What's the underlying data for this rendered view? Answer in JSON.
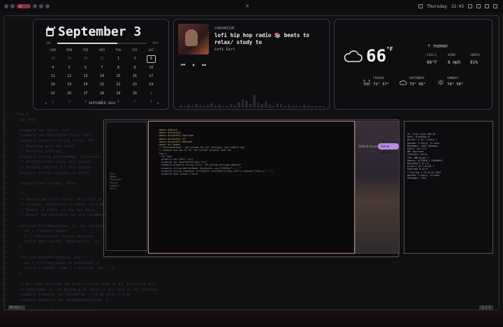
{
  "topbar": {
    "center_glyph": "⌘",
    "day": "Thursday",
    "time": "21:43"
  },
  "calendar": {
    "title": "September 3",
    "progress_left": "28%",
    "progress_right": "67%",
    "progress_fraction": 0.67,
    "weekdays": [
      "SUN",
      "MON",
      "TUE",
      "WED",
      "THU",
      "FRI",
      "SAT"
    ],
    "days": [
      [
        "28",
        "29",
        "30",
        "31",
        "1",
        "2",
        "3"
      ],
      [
        "4",
        "5",
        "6",
        "7",
        "8",
        "9",
        "10"
      ],
      [
        "11",
        "12",
        "13",
        "14",
        "15",
        "16",
        "17"
      ],
      [
        "18",
        "19",
        "20",
        "21",
        "22",
        "23",
        "24"
      ],
      [
        "25",
        "26",
        "27",
        "28",
        "29",
        "30",
        "1"
      ],
      [
        "2",
        "3",
        "4",
        "5",
        "6",
        "7",
        "8"
      ]
    ],
    "today": "3",
    "footer_prev": "◂",
    "footer_label": "SEPTEMBER 2024",
    "footer_next": "▸"
  },
  "media": {
    "source": "CHROMIUM",
    "title": "lofi hip hop radio 📚 beats to relax/ study to",
    "artist": "Lofi Girl",
    "prev_icon": "⏮",
    "play_icon": "⏸",
    "next_icon": "⏭"
  },
  "weather": {
    "temp": "66",
    "unit": "°F",
    "location": "FREMONT",
    "feels_label": "FEELS",
    "feels_value": "66°F",
    "wind_label": "WIND",
    "wind_value": "6 mph",
    "humid_label": "HUMID",
    "humid_value": "81%",
    "forecast": [
      {
        "day": "FRIDAY",
        "temps": "71° 57°",
        "icon": "fog-icon"
      },
      {
        "day": "SATURDAY",
        "temps": "73° 56°",
        "icon": "cloud-icon"
      },
      {
        "day": "SUNDAY",
        "temps": "74° 58°",
        "icon": "sun-icon"
      }
    ]
  },
  "editor": {
    "lines": [
      {
        "n": "12",
        "t": "Item {"
      },
      {
        "n": "13",
        "t": "  id: root"
      },
      {
        "n": "14",
        "t": ""
      },
      {
        "n": "15",
        "t": "  property var shell: null"
      },
      {
        "n": "16",
        "t": "  property var displaySettings: null"
      },
      {
        "n": "17",
        "t": "  readonly property string title: \"Qt\""
      },
      {
        "n": "18",
        "t": "  // Mounting with the shell..."
      },
      {
        "n": "19",
        "t": "  // Mounting settings..."
      },
      {
        "n": "20",
        "t": "  property string monitorName: Quickshell"
      },
      {
        "n": "21",
        "t": "  // Notifications using this object..."
      },
      {
        "n": "22",
        "t": "  // Display options for this window"
      },
      {
        "n": "23",
        "t": "  property string iconpath:qs.Paths"
      },
      {
        "n": "24",
        "t": ""
      },
      {
        "n": "25",
        "t": "  property bool visual: false"
      },
      {
        "n": "26",
        "t": ""
      },
      {
        "n": "27",
        "t": "  //"
      },
      {
        "n": "28",
        "t": "  // Serialized list (notes) this file is"
      },
      {
        "n": "29",
        "t": "  // Strings, conversion to number on a data"
      },
      {
        "n": "30",
        "t": "  // Number of ticks, string key value"
      },
      {
        "n": "31",
        "t": "  // expert the available (we are recommending"
      },
      {
        "n": "32",
        "t": ""
      },
      {
        "n": "33",
        "t": "  function FitToNum(value, lo, hi, fallback"
      },
      {
        "n": "34",
        "t": "    var n = Number(value)"
      },
      {
        "n": "35",
        "t": "    if (!isFinite(n)) return fallback"
      },
      {
        "n": "36",
        "t": "    return Math.min(hi, Math.max(lo, n))"
      },
      {
        "n": "37",
        "t": "  }"
      },
      {
        "n": "38",
        "t": ""
      },
      {
        "n": "39",
        "t": "  function boundText(value, max) {"
      },
      {
        "n": "40",
        "t": "    var s = String(value == undefined ||"
      },
      {
        "n": "41",
        "t": "    return s.length > max ? s.slice(0, max) : s"
      },
      {
        "n": "42",
        "t": "  }"
      },
      {
        "n": "43",
        "t": ""
      },
      {
        "n": "44",
        "t": "  // All code executed (no pixels before gone at all BlurStack etc)"
      },
      {
        "n": "45",
        "t": "  // Timestamps at the minute with (easy to do) this is all setting"
      },
      {
        "n": "46",
        "t": "  readonly property var validFrom: /^[A-Za-z0-9._\\-]+$/"
      },
      {
        "n": "47",
        "t": "  readonly property int asideWidthMaximum: 7"
      },
      {
        "n": "48",
        "t": ""
      },
      {
        "n": "49",
        "t": "  function semiIsArray(list, fallback) {"
      },
      {
        "n": "50",
        "t": "    if (!Array.isArray(list)) return fallback"
      },
      {
        "n": "51",
        "t": "    var out = []"
      }
    ]
  },
  "overview": {
    "browser_tab": "Default browser",
    "browser_button": "Set as default",
    "main_code": [
      "import QtQuick",
      "import Quickshell",
      "import Quickshell.Hyprland",
      "import Quickshell.Io",
      "import Quickshell.Wayland",
      "import qs.Common",
      "",
      "// SettingsWindow - one window for all settings; this module and",
      "// exposes one new UI for the current display (and the",
      "",
      "Item {",
      "  id: root",
      "",
      "  property var shell: null",
      "  property var displaySettings: null",
      "  readonly property string title: \"QS_github_settings_modules\"",
      "  property string monitorName: Quickshell.env(\"DISPLAY\") || \"\"",
      "  property string iconpath: StringCalc.resolveUri(\"save.conf\").replace(\"file://\", \"\")",
      "",
      "  property bool visual: false"
    ],
    "side_code": [
      "OS: Arch Linux x86_64",
      "Host: ThinkPad X1",
      "Kernel: 6.10.7-arch1-1",
      "Uptime: 3 hours, 12 mins",
      "Packages: 1204 (pacman)",
      "Shell: zsh 5.9",
      "WM: Hyprland",
      "Terminal: kitty",
      "CPU: AMD Ryzen 7",
      "Memory: 6213MiB / 31000MiB",
      "",
      "Quickshell 0.1.0",
      "Linux 6.10.7-arch1-1",
      "Hyprland 0.42.0",
      "",
      "* Thu Sep 3 21:43:12 2024",
      "Uptime: 3 hours, 12 mins",
      "Packages: 1204"
    ],
    "left_code": [
      "\"Sec\"",
      "\"Mode\"",
      "",
      "",
      "\"Position\"",
      "",
      "\"Style\"",
      "",
      "\"Layout\"",
      "",
      "\"HiFi\""
    ]
  },
  "bottom": {
    "left_label": "Normal",
    "right_label": "1 | 1"
  }
}
